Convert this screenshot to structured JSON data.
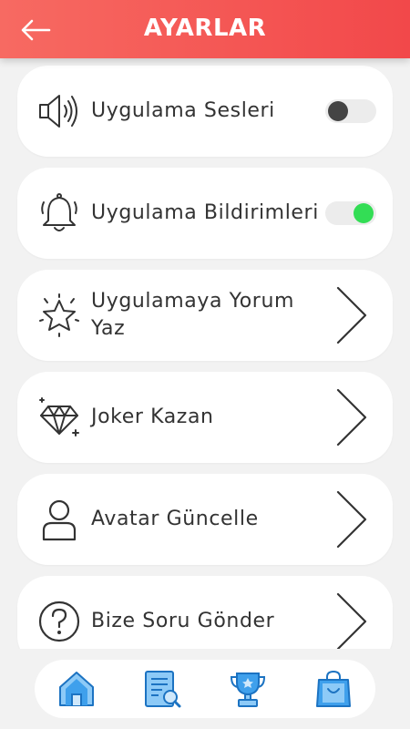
{
  "header": {
    "title": "AYARLAR",
    "back_icon": "arrow-left-icon"
  },
  "settings": [
    {
      "label": "Uygulama Sesleri",
      "icon": "speaker-icon",
      "control": "toggle",
      "toggle_on": false
    },
    {
      "label": "Uygulama Bildirimleri",
      "icon": "bell-icon",
      "control": "toggle",
      "toggle_on": true
    },
    {
      "label": "Uygulamaya Yorum Yaz",
      "icon": "star-icon",
      "control": "chevron"
    },
    {
      "label": "Joker Kazan",
      "icon": "diamond-icon",
      "control": "chevron"
    },
    {
      "label": "Avatar Güncelle",
      "icon": "user-icon",
      "control": "chevron"
    },
    {
      "label": "Bize Soru Gönder",
      "icon": "question-icon",
      "control": "chevron"
    }
  ],
  "bottom_nav": [
    {
      "icon": "home-icon"
    },
    {
      "icon": "list-search-icon"
    },
    {
      "icon": "trophy-icon"
    },
    {
      "icon": "shopping-bag-icon"
    }
  ],
  "colors": {
    "header_start": "#f76a62",
    "header_end": "#f2484a",
    "toggle_on": "#33dd55",
    "toggle_off_knob": "#444444",
    "nav_icon": "#3fa0ec"
  }
}
